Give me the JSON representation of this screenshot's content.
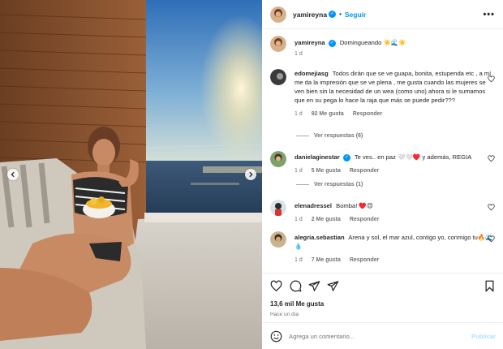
{
  "post": {
    "username": "yamireyna",
    "follow_label": "Seguir",
    "separator": "•",
    "more_label": "•••",
    "caption": "Domingueando ☀️🌊☀️",
    "caption_time": "1 d",
    "likes_label": "13,6 mil Me gusta",
    "time_ago": "Hace un día"
  },
  "comments": [
    {
      "username": "edomejiasg",
      "text": "Todos dirán que se ve guapa, bonita, estupenda etc , a mí me da la impresión que se ve plena , me gusta cuando las mujeres se ven bien sin la necesidad de un wea (como uno) ahora si le sumamos que en su pega lo hace la raja que más se puede pedir???",
      "time": "1 d",
      "likes": "92 Me gusta",
      "reply": "Responder",
      "view_replies": "Ver respuestas (6)"
    },
    {
      "username": "danielaginestar",
      "text": "Te ves.. en paz 🤍🤍♥️ y además, REGIA",
      "time": "1 d",
      "likes": "5 Me gusta",
      "reply": "Responder",
      "view_replies": "Ver respuestas (1)"
    },
    {
      "username": "elenadressel",
      "text": "Bomba! ♥️😍",
      "time": "1 d",
      "likes": "2 Me gusta",
      "reply": "Responder"
    },
    {
      "username": "alegria.sebastian",
      "text": "Arena y sol, el mar azul, contigo yo, conmigo tu🔥🌊💧",
      "time": "1 d",
      "likes": "7 Me gusta",
      "reply": "Responder"
    }
  ],
  "composer": {
    "placeholder": "Agrega un comentario...",
    "publish_label": "Publicar"
  },
  "colors": {
    "accent": "#0095f6",
    "accent_disabled": "#b2dffc",
    "text": "#262626",
    "secondary": "#737373"
  },
  "icons": {
    "header": [
      "more-options-icon"
    ],
    "actions": [
      "heart-icon",
      "comment-icon",
      "share-icon",
      "bookmark-icon"
    ],
    "photo": [
      "carousel-prev-icon",
      "carousel-next-icon"
    ],
    "composer": [
      "emoji-icon"
    ]
  }
}
